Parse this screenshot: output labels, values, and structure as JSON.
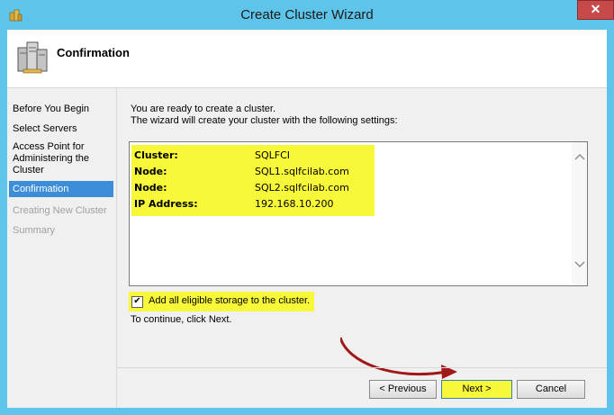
{
  "window": {
    "title": "Create Cluster Wizard",
    "close_glyph": "✕"
  },
  "header": {
    "title": "Confirmation",
    "icon": "cluster-servers-icon"
  },
  "steps": [
    {
      "label": "Before You Begin",
      "state": "normal"
    },
    {
      "label": "Select Servers",
      "state": "normal"
    },
    {
      "label": "Access Point for Administering the Cluster",
      "state": "normal"
    },
    {
      "label": "Confirmation",
      "state": "active"
    },
    {
      "label": "Creating New Cluster",
      "state": "disabled"
    },
    {
      "label": "Summary",
      "state": "disabled"
    }
  ],
  "main": {
    "intro_line1": "You are ready to create a cluster.",
    "intro_line2": "The wizard will create your cluster with the following settings:",
    "settings": [
      {
        "key": "Cluster:",
        "value": "SQLFCI"
      },
      {
        "key": "Node:",
        "value": "SQL1.sqlfcilab.com"
      },
      {
        "key": "Node:",
        "value": "SQL2.sqlfcilab.com"
      },
      {
        "key": "IP Address:",
        "value": "192.168.10.200"
      }
    ],
    "checkbox_label": "Add all eligible storage to the cluster.",
    "checkbox_checked": true,
    "checkbox_mark": "✔",
    "continue_text": "To continue, click Next."
  },
  "buttons": {
    "previous": "< Previous",
    "next": "Next >",
    "cancel": "Cancel"
  },
  "colors": {
    "highlight": "#f8f83a",
    "title_bar": "#5ec4ea",
    "active_step": "#3d8ed8",
    "arrow": "#a01818"
  }
}
